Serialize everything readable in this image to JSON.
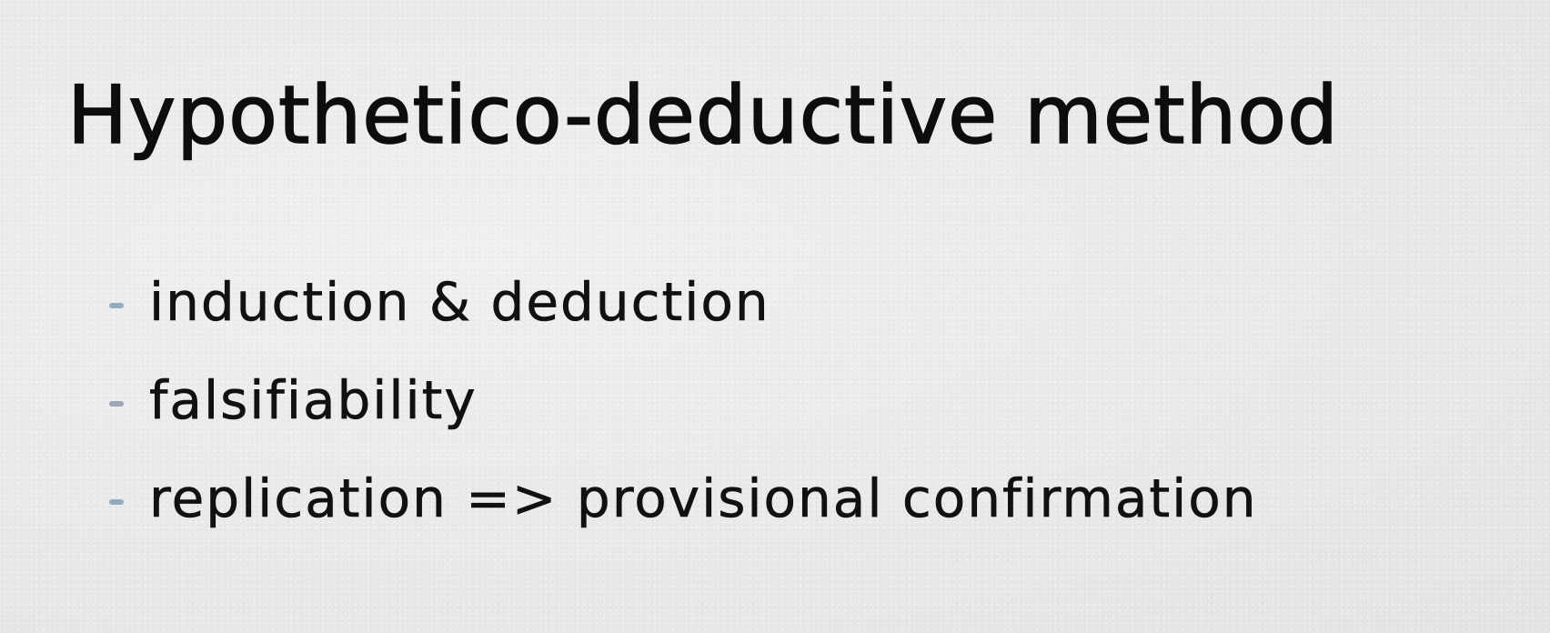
{
  "slide": {
    "title": "Hypothetico-deductive method",
    "bullets": [
      {
        "text": "induction & deduction"
      },
      {
        "text": "falsifiability"
      },
      {
        "text": "replication => provisional confirmation"
      }
    ]
  },
  "colors": {
    "background": "#ececec",
    "text": "#111111",
    "bullet_dash": "#9aa9b7"
  }
}
